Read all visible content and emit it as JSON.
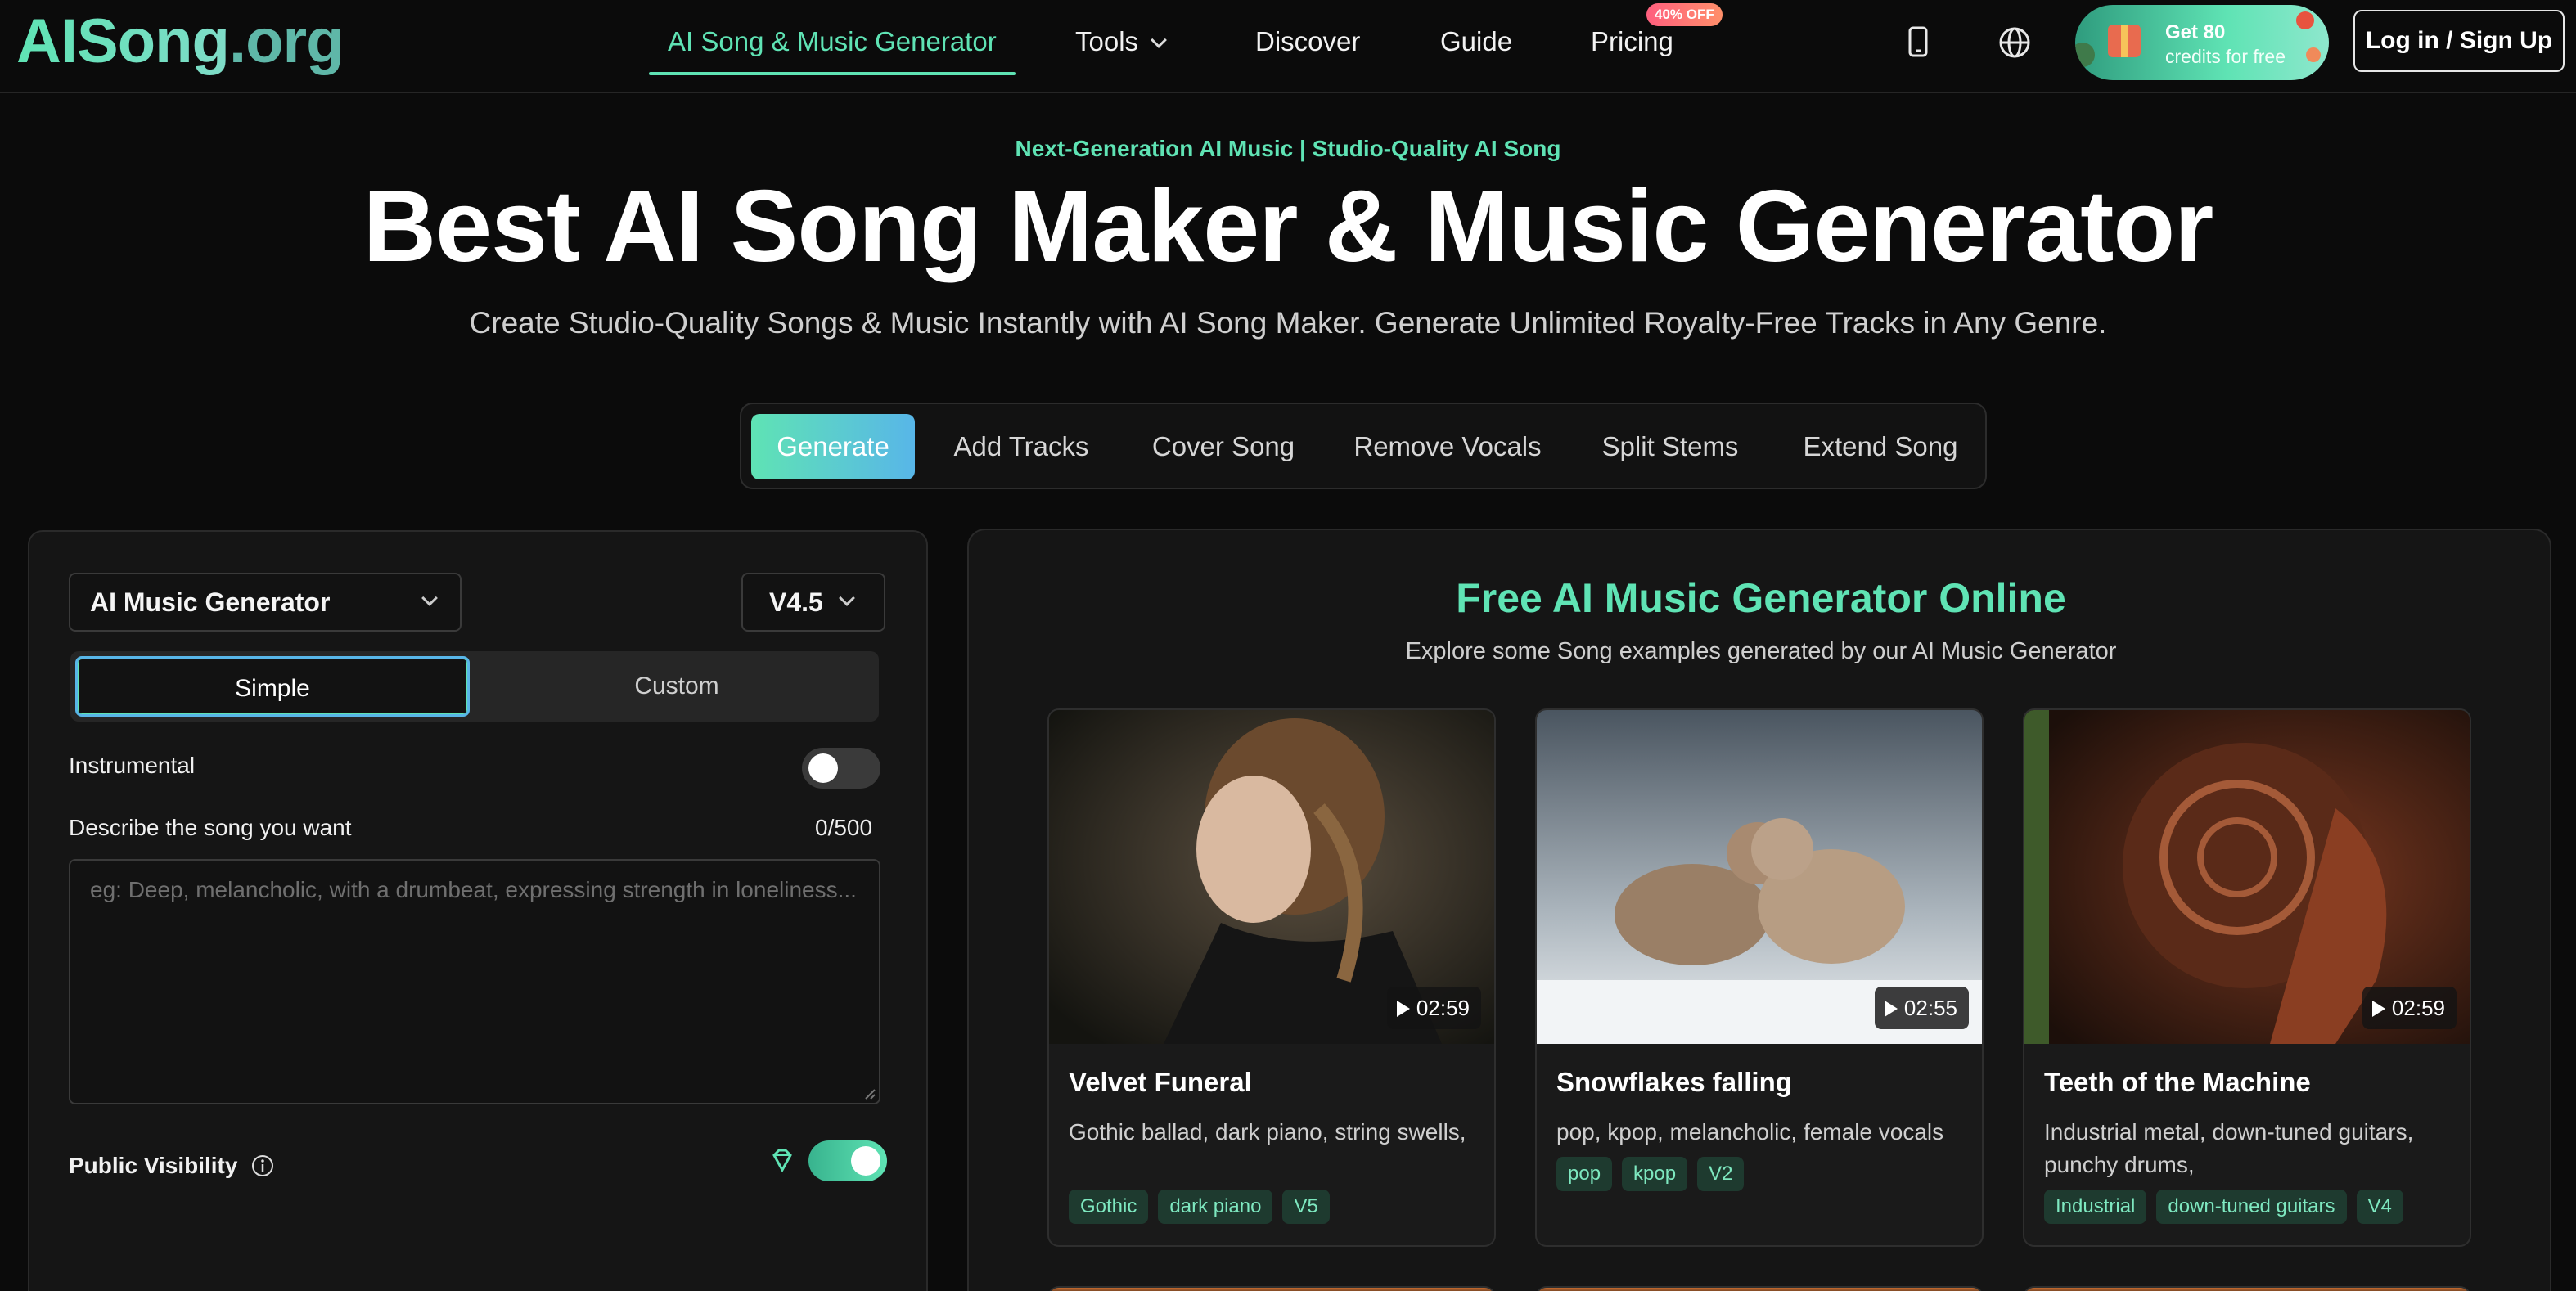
{
  "nav": {
    "logo_main": "AISong",
    "logo_tld": ".org",
    "items": [
      "AI Song & Music Generator",
      "Tools",
      "Discover",
      "Guide",
      "Pricing"
    ],
    "pricing_badge": "40% OFF",
    "promo_line1": "Get 80",
    "promo_line2": "credits for free",
    "login_label": "Log in / Sign Up",
    "icons": [
      "phone-icon",
      "globe-icon",
      "gift-icon"
    ]
  },
  "hero": {
    "eyebrow": "Next-Generation AI Music | Studio-Quality AI Song",
    "title": "Best AI Song Maker & Music Generator",
    "subtitle": "Create Studio-Quality Songs & Music Instantly with AI Song Maker. Generate Unlimited Royalty-Free Tracks in Any Genre."
  },
  "tabs": [
    "Generate",
    "Add Tracks",
    "Cover Song",
    "Remove Vocals",
    "Split Stems",
    "Extend Song"
  ],
  "form": {
    "mode_select": "AI Music Generator",
    "version_select": "V4.5",
    "segments": [
      "Simple",
      "Custom"
    ],
    "instrumental_label": "Instrumental",
    "instrumental_on": false,
    "describe_label": "Describe the song you want",
    "char_count": "0/500",
    "describe_placeholder": "eg: Deep, melancholic, with a drumbeat, expressing strength in loneliness...",
    "visibility_label": "Public Visibility",
    "visibility_on": true
  },
  "showcase": {
    "title": "Free AI Music Generator Online",
    "subtitle": "Explore some Song examples generated by our AI Music Generator",
    "cards": [
      {
        "title": "Velvet Funeral",
        "duration": "02:59",
        "description": "Gothic ballad, dark piano, string swells,",
        "tags": [
          "Gothic",
          "dark piano",
          "V5"
        ]
      },
      {
        "title": "Snowflakes falling",
        "duration": "02:55",
        "description": "pop, kpop, melancholic, female vocals",
        "tags": [
          "pop",
          "kpop",
          "V2"
        ]
      },
      {
        "title": "Teeth of the Machine",
        "duration": "02:59",
        "description": "Industrial metal, down-tuned guitars, punchy drums,",
        "tags": [
          "Industrial",
          "down-tuned guitars",
          "V4"
        ]
      }
    ]
  },
  "colors": {
    "accent": "#5fe3b4",
    "accent2": "#58b6e8",
    "bg": "#0b0b0b",
    "panel": "#151515"
  }
}
